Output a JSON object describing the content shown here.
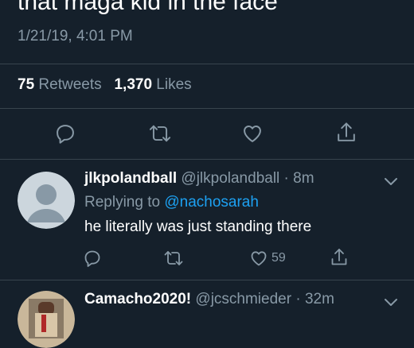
{
  "tweet": {
    "text": "that maga kid in the face",
    "timestamp": "1/21/19, 4:01 PM",
    "retweets_count": "75",
    "retweets_label": "Retweets",
    "likes_count": "1,370",
    "likes_label": "Likes"
  },
  "replies": [
    {
      "name": "jlkpolandball",
      "handle": "@jlkpolandball · 8m",
      "replying_prefix": "Replying to",
      "replying_to": "@nachosarah",
      "text": "he literally was just standing there",
      "likes": "59"
    },
    {
      "name": "Camacho2020!",
      "handle": "@jcschmieder · 32m"
    }
  ],
  "colors": {
    "background": "#15202b",
    "secondary_text": "#8899a6",
    "link": "#1da1f2",
    "divider": "#38444d"
  },
  "icons": [
    "reply-icon",
    "retweet-icon",
    "like-icon",
    "share-icon",
    "chevron-down-icon",
    "default-avatar-icon"
  ]
}
